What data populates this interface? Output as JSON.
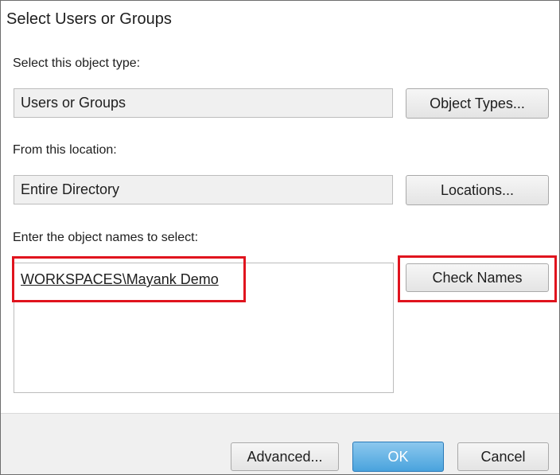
{
  "dialog": {
    "title": "Select Users or Groups"
  },
  "object_type": {
    "label": "Select this object type:",
    "value": "Users or Groups",
    "button": "Object Types..."
  },
  "location": {
    "label": "From this location:",
    "value": "Entire Directory",
    "button": "Locations..."
  },
  "names": {
    "label": "Enter the object names to select:",
    "entry": "WORKSPACES\\Mayank Demo",
    "check_button": "Check Names"
  },
  "footer": {
    "advanced": "Advanced...",
    "ok": "OK",
    "cancel": "Cancel"
  },
  "colors": {
    "highlight": "#e0141e",
    "ok_button": "#4aa3dd"
  }
}
